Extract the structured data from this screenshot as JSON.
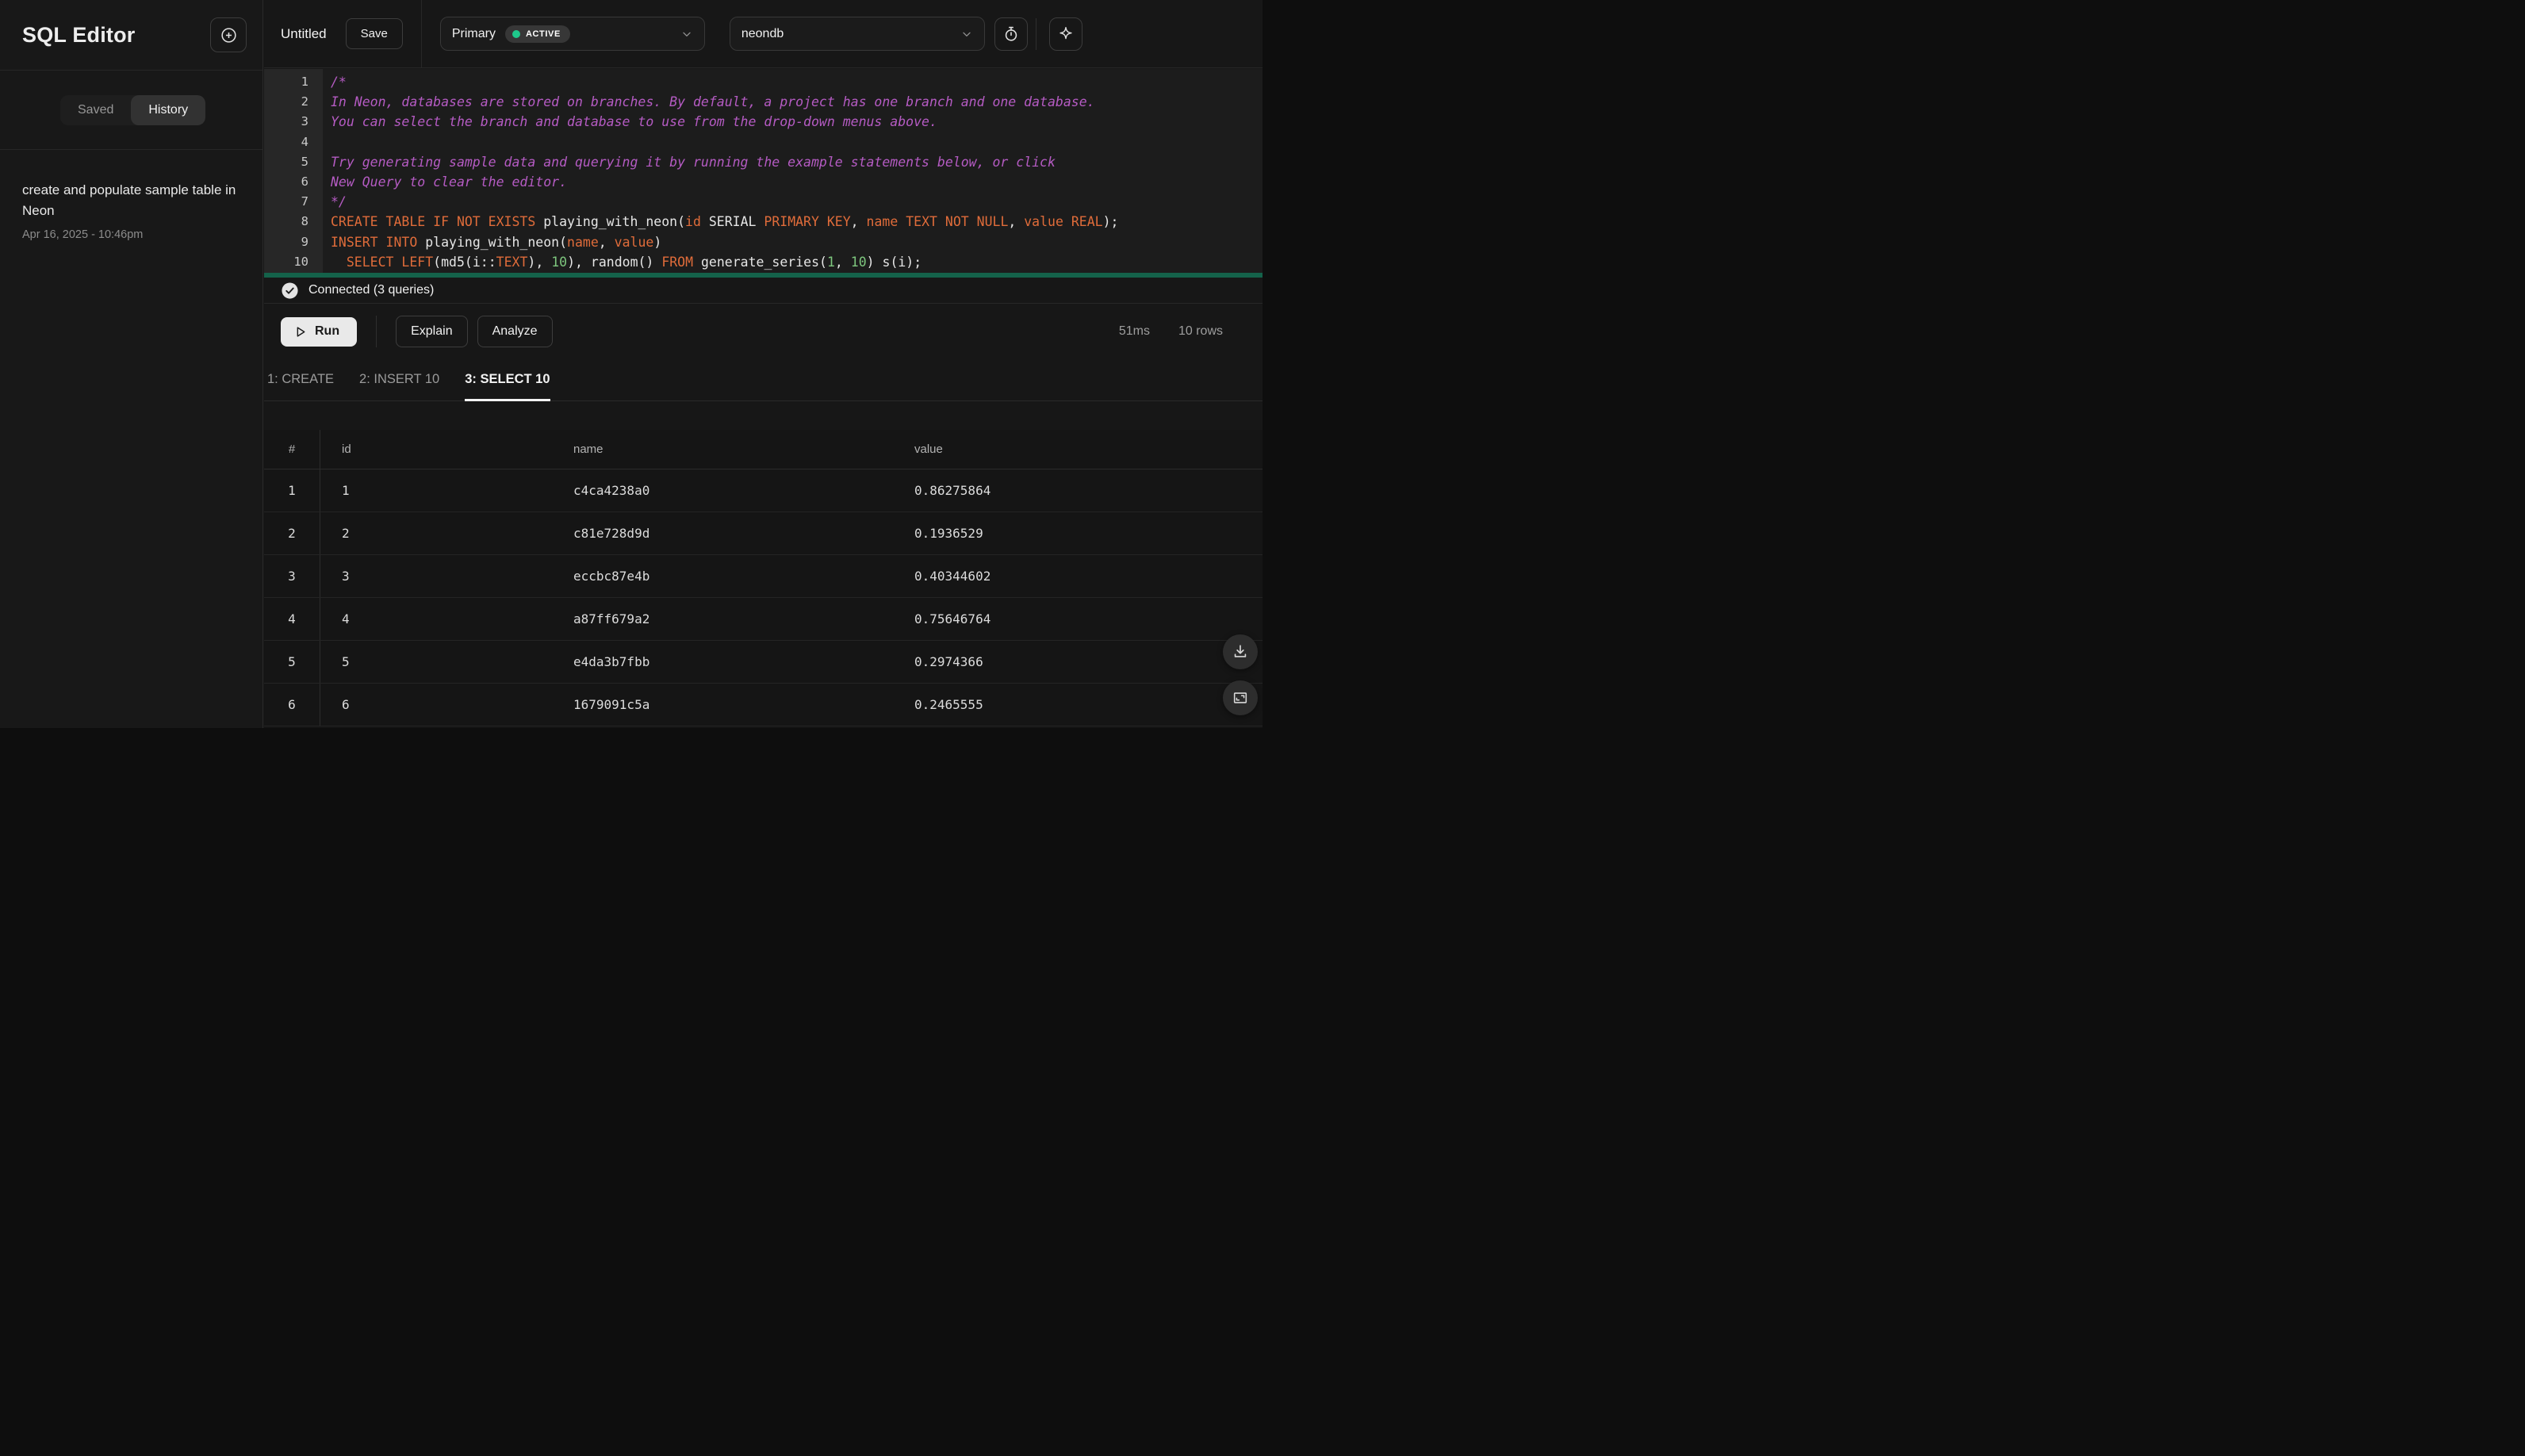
{
  "sidebar": {
    "title": "SQL Editor",
    "tabs": {
      "saved": "Saved",
      "history": "History"
    },
    "history_item": {
      "title": "create and populate sample table in Neon",
      "date": "Apr 16, 2025 - 10:46pm"
    }
  },
  "topbar": {
    "file_name": "Untitled",
    "save_label": "Save",
    "branch": {
      "name": "Primary",
      "status": "ACTIVE"
    },
    "database": "neondb"
  },
  "editor": {
    "lines": [
      {
        "num": "1",
        "tokens": [
          [
            "/*",
            "c"
          ]
        ]
      },
      {
        "num": "2",
        "tokens": [
          [
            "In Neon, databases are stored on branches. By default, a project has one branch and one database.",
            "c"
          ]
        ]
      },
      {
        "num": "3",
        "tokens": [
          [
            "You can select the branch and database to use from the drop-down menus above.",
            "c"
          ]
        ]
      },
      {
        "num": "4",
        "tokens": []
      },
      {
        "num": "5",
        "tokens": [
          [
            "Try generating sample data and querying it by running the example statements below, or click",
            "c"
          ]
        ]
      },
      {
        "num": "6",
        "tokens": [
          [
            "New Query to clear the editor.",
            "c"
          ]
        ]
      },
      {
        "num": "7",
        "tokens": [
          [
            "*/",
            "c"
          ]
        ]
      },
      {
        "num": "8",
        "tokens": [
          [
            "CREATE TABLE IF NOT EXISTS",
            "k"
          ],
          [
            " playing_with_neon(",
            "p"
          ],
          [
            "id",
            "k"
          ],
          [
            " SERIAL ",
            "p"
          ],
          [
            "PRIMARY KEY",
            "k"
          ],
          [
            ", ",
            "p"
          ],
          [
            "name",
            "k"
          ],
          [
            " ",
            "p"
          ],
          [
            "TEXT NOT NULL",
            "k"
          ],
          [
            ", ",
            "p"
          ],
          [
            "value",
            "k"
          ],
          [
            " ",
            "p"
          ],
          [
            "REAL",
            "k"
          ],
          [
            ");",
            "p"
          ]
        ]
      },
      {
        "num": "9",
        "tokens": [
          [
            "INSERT INTO",
            "k"
          ],
          [
            " playing_with_neon(",
            "p"
          ],
          [
            "name",
            "k"
          ],
          [
            ", ",
            "p"
          ],
          [
            "value",
            "k"
          ],
          [
            ")",
            "p"
          ]
        ]
      },
      {
        "num": "10",
        "tokens": [
          [
            "  ",
            "p"
          ],
          [
            "SELECT",
            "k"
          ],
          [
            " ",
            "p"
          ],
          [
            "LEFT",
            "k"
          ],
          [
            "(md5(i::",
            "p"
          ],
          [
            "TEXT",
            "k"
          ],
          [
            "), ",
            "p"
          ],
          [
            "10",
            "n"
          ],
          [
            "), random() ",
            "p"
          ],
          [
            "FROM",
            "k"
          ],
          [
            " generate_series(",
            "p"
          ],
          [
            "1",
            "n"
          ],
          [
            ", ",
            "p"
          ],
          [
            "10",
            "n"
          ],
          [
            ") s(i);",
            "p"
          ]
        ]
      }
    ]
  },
  "status": {
    "connected": "Connected (3 queries)"
  },
  "actions": {
    "run": "Run",
    "explain": "Explain",
    "analyze": "Analyze",
    "duration": "51ms",
    "rows": "10 rows"
  },
  "result_tabs": [
    {
      "label": "1: CREATE",
      "active": false
    },
    {
      "label": "2: INSERT 10",
      "active": false
    },
    {
      "label": "3: SELECT 10",
      "active": true
    }
  ],
  "table": {
    "columns": [
      "#",
      "id",
      "name",
      "value"
    ],
    "rows": [
      {
        "n": "1",
        "id": "1",
        "name": "c4ca4238a0",
        "value": "0.86275864"
      },
      {
        "n": "2",
        "id": "2",
        "name": "c81e728d9d",
        "value": "0.1936529"
      },
      {
        "n": "3",
        "id": "3",
        "name": "eccbc87e4b",
        "value": "0.40344602"
      },
      {
        "n": "4",
        "id": "4",
        "name": "a87ff679a2",
        "value": "0.75646764"
      },
      {
        "n": "5",
        "id": "5",
        "name": "e4da3b7fbb",
        "value": "0.2974366"
      },
      {
        "n": "6",
        "id": "6",
        "name": "1679091c5a",
        "value": "0.2465555"
      }
    ]
  },
  "colors": {
    "active_dot": "#1ec98b",
    "keyword": "#e06c3a",
    "comment": "#b55bc3",
    "number": "#7ec77e",
    "editor_bottom_bar": "#14624a"
  }
}
